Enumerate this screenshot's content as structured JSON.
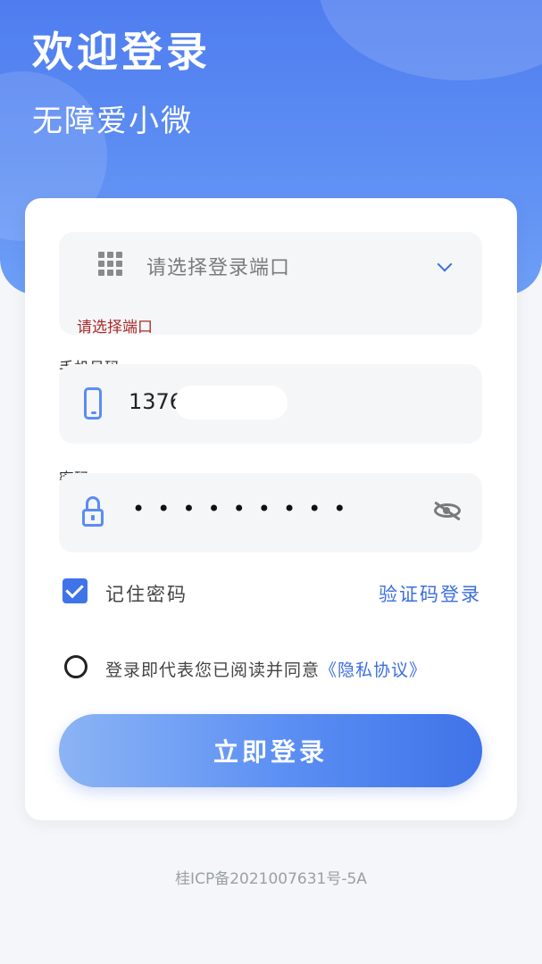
{
  "header": {
    "title": "欢迎登录",
    "subtitle": "无障爱小微"
  },
  "form": {
    "portal_select": {
      "placeholder": "请选择登录端口",
      "error": "请选择端口"
    },
    "phone": {
      "label": "手机号码",
      "value": "1376"
    },
    "password": {
      "label": "密码",
      "masked_value": "•••••••••"
    },
    "remember": {
      "label": "记住密码",
      "checked": true
    },
    "code_login_link": "验证码登录",
    "agreement": {
      "text": "登录即代表您已阅读并同意",
      "link": "《隐私协议》",
      "checked": false
    },
    "submit_label": "立即登录"
  },
  "footer": {
    "icp": "桂ICP备2021007631号-5A"
  },
  "colors": {
    "primary": "#3f73e8",
    "hero_start": "#4f7df0",
    "error": "#a82b2b"
  }
}
